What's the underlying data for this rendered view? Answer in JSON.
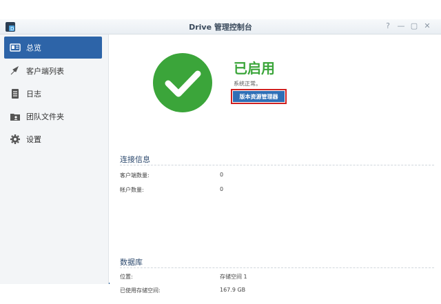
{
  "window": {
    "title": "Drive 管理控制台",
    "controls": {
      "help": "?",
      "minimize": "—",
      "maximize": "▢",
      "close": "✕"
    }
  },
  "sidebar": {
    "items": [
      {
        "label": "总览",
        "icon": "overview-icon",
        "active": true
      },
      {
        "label": "客户端列表",
        "icon": "client-list-icon",
        "active": false
      },
      {
        "label": "日志",
        "icon": "log-icon",
        "active": false
      },
      {
        "label": "团队文件夹",
        "icon": "team-folder-icon",
        "active": false
      },
      {
        "label": "设置",
        "icon": "gear-icon",
        "active": false
      }
    ]
  },
  "status": {
    "title": "已启用",
    "subtitle": "系统正常。",
    "button_label": "版本资源管理器",
    "color": "#3ba53a"
  },
  "connection": {
    "heading": "连接信息",
    "rows": [
      {
        "label": "客户端数量:",
        "value": "0"
      },
      {
        "label": "帐户数量:",
        "value": "0"
      }
    ]
  },
  "database": {
    "heading": "数据库",
    "rows": [
      {
        "label": "位置:",
        "value": "存储空间 1"
      },
      {
        "label": "已使用存储空间:",
        "value": "167.9 GB"
      }
    ]
  },
  "colors": {
    "accent": "#2d64a8",
    "highlight_border": "#d02020",
    "success": "#3ba53a"
  }
}
